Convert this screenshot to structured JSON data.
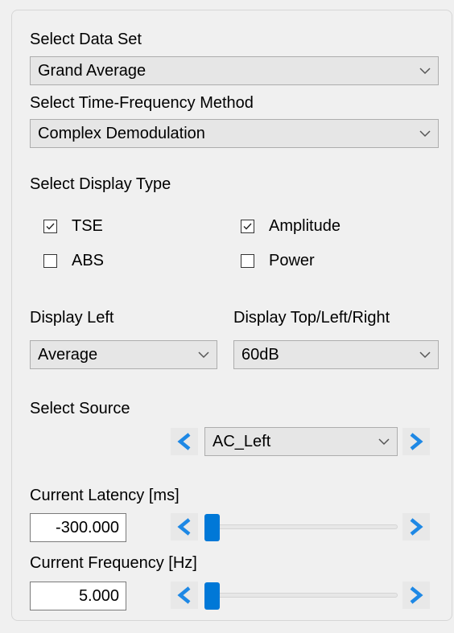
{
  "data_set": {
    "label": "Select Data Set",
    "value": "Grand Average"
  },
  "tf_method": {
    "label": "Select Time-Frequency Method",
    "value": "Complex Demodulation"
  },
  "display_type": {
    "label": "Select Display Type",
    "options": [
      {
        "label": "TSE",
        "checked": true
      },
      {
        "label": "Amplitude",
        "checked": true
      },
      {
        "label": "ABS",
        "checked": false
      },
      {
        "label": "Power",
        "checked": false
      }
    ]
  },
  "display_left": {
    "label": "Display Left",
    "value": "Average"
  },
  "display_top": {
    "label": "Display Top/Left/Right",
    "value": "60dB"
  },
  "source": {
    "label": "Select Source",
    "value": "AC_Left"
  },
  "latency": {
    "label": "Current Latency [ms]",
    "value": "-300.000",
    "slider_fraction": 0.0
  },
  "frequency": {
    "label": "Current Frequency [Hz]",
    "value": "5.000",
    "slider_fraction": 0.0
  },
  "colors": {
    "accent": "#0078d7",
    "arrow": "#1e88e5",
    "control_bg": "#e6e6e6",
    "panel_bg": "#f0f0f0"
  },
  "icons": {
    "dropdown": "chevron-down-icon",
    "prev": "chevron-left-icon",
    "next": "chevron-right-icon",
    "check": "checkmark-icon"
  }
}
